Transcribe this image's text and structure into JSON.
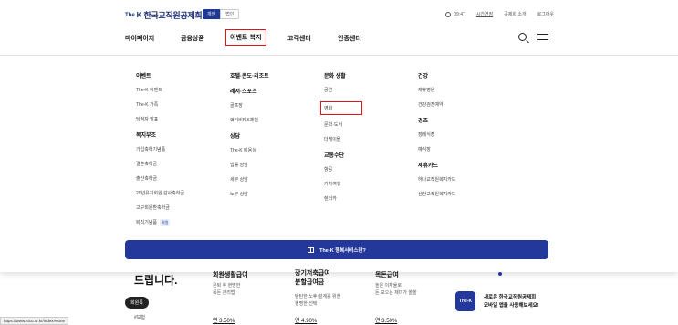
{
  "brand": {
    "the": "The",
    "k": "K",
    "name": "한국교직원공제회"
  },
  "segment": {
    "personal": "개인",
    "corporate": "법인"
  },
  "util": {
    "time": "09:47",
    "extend": "시간연장",
    "intro": "공제회 소개",
    "logout": "로그아웃"
  },
  "nav": {
    "items": [
      "마이페이지",
      "금융상품",
      "이벤트·복지",
      "고객센터",
      "인증센터"
    ],
    "active_index": 2
  },
  "menu": {
    "col1": {
      "heading": "이벤트",
      "links": [
        "The-K 이벤트",
        "The-K 가족",
        "당첨자 발표"
      ],
      "heading2": "복지부조",
      "links2": [
        "가입축하기념품",
        "결혼축하금",
        "출산축하금",
        "20년유지회원 감사축하금",
        "고구회원환축하금",
        "퇴직기념품"
      ],
      "new_tag": "회원"
    },
    "col2": {
      "heading": "호텔·콘도·리조트",
      "heading2": "레저·스포츠",
      "links2": [
        "골프장",
        "액티비티&체험"
      ],
      "heading3": "상담",
      "links3": [
        "The-K 미용실",
        "법률 상담",
        "세무 상담",
        "노무 상담"
      ]
    },
    "col3": {
      "heading": "문화 생활",
      "links": [
        "공연",
        "영화",
        "문학·도서",
        "더케이몰"
      ],
      "highlighted": "영화",
      "heading2": "교통수단",
      "links2": [
        "항공",
        "기차여행",
        "렌터카"
      ]
    },
    "col4": {
      "heading": "건강",
      "links": [
        "제휴병원",
        "건강검진예약"
      ],
      "heading2": "경조",
      "links2": [
        "장례식장",
        "예식장"
      ],
      "heading3": "제휴카드",
      "links3": [
        "하나교직원복지카드",
        "신한교직원복지카드"
      ]
    },
    "banner": "The-K 행복서비스란?"
  },
  "below": {
    "big_text": "드립니다.",
    "pill": "회원목",
    "small": "#보험",
    "card1": {
      "title": "회원생활급여",
      "desc1": "은퇴 후 현명한",
      "desc2": "목돈 관리법",
      "rate": "연 3.50%"
    },
    "card2": {
      "title1": "장기저축급여",
      "title2": "분할급여금",
      "desc1": "탄탄한 노후 설계를 위한",
      "desc2": "현명한 선택",
      "rate": "연 4.90%"
    },
    "card3": {
      "title": "목돈급여",
      "desc1": "높은 이자율로",
      "desc2": "돈 모으는 재미가 쏠쏠",
      "rate": "연 3.50%"
    },
    "app_icon": "The-K",
    "app_line1": "새로운 한국교직원공제회",
    "app_line2": "모바일 앱을 사용해보세요!",
    "status_url": "https://www.ktcu.or.kr/index#none"
  }
}
